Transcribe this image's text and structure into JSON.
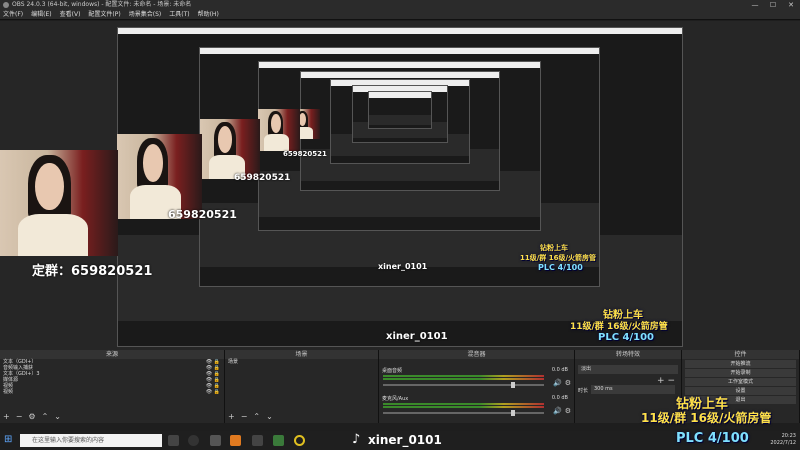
{
  "window": {
    "title": "OBS 24.0.3 (64-bit, windows) - 配置文件: 未命名 - 场景: 未命名",
    "minimize": "—",
    "maximize": "☐",
    "close": "✕"
  },
  "menu": [
    "文件(F)",
    "编辑(E)",
    "查看(V)",
    "配置文件(P)",
    "场景集合(S)",
    "工具(T)",
    "帮助(H)"
  ],
  "preview": {
    "cam_number": "659820521",
    "group_caption": "定群：659820521",
    "tiktok_user": "xiner_0101",
    "overlay_line1": "钻粉上车",
    "overlay_line2": "11级/群 16级/火箭房管",
    "overlay_line3": "PLC 4/100",
    "overlay_color_gold": "#ffe14a",
    "overlay_color_blue": "#7fe0ff"
  },
  "docks": {
    "sources": {
      "header": "来源",
      "items": [
        "文本（GDI+）",
        "音频输入捕获",
        "文本（GDI+）3",
        "媒体源",
        "视频",
        "视频"
      ]
    },
    "scenes_panel": {
      "header": "场景",
      "items": [
        "场景"
      ]
    },
    "mixer": {
      "header": "混音器",
      "channels": [
        {
          "label": "桌面音频",
          "value": "0.0 dB"
        },
        {
          "label": "麦克风/Aux",
          "value": "0.0 dB"
        }
      ]
    },
    "transitions": {
      "header": "转场特效",
      "type": "淡出",
      "duration_label": "时长",
      "duration_value": "300 ms"
    },
    "controls": {
      "header": "控件",
      "buttons": [
        "开始推流",
        "开始录制",
        "工作室模式",
        "设置",
        "退出"
      ]
    }
  },
  "taskbar": {
    "search_placeholder": "在这里输入你要搜索的内容",
    "time": "20:23",
    "date": "2022/7/12",
    "tiktok_user": "xiner_0101"
  }
}
